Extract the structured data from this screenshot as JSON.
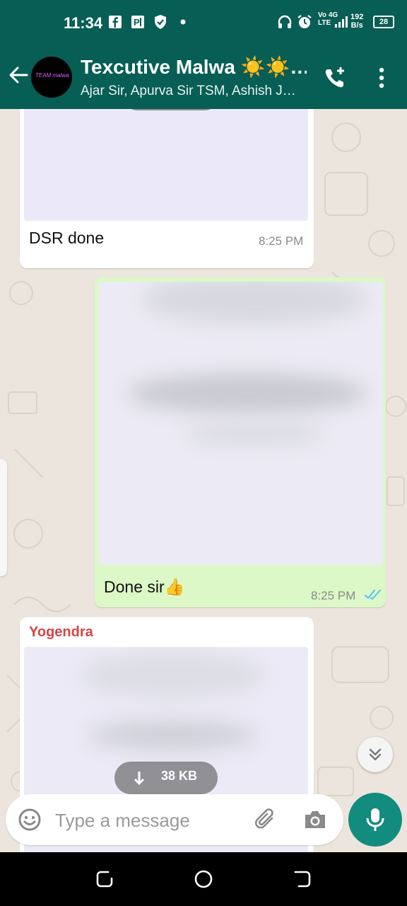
{
  "status_bar": {
    "time": "11:34",
    "network_top": "Vo 4G",
    "network_bottom": "LTE",
    "speed_value": "192",
    "speed_unit": "B/s",
    "battery": "28",
    "icons": [
      "facebook-icon",
      "parking-icon",
      "shield-icon",
      "dot-icon",
      "headphones-icon",
      "alarm-icon",
      "signal-icon",
      "battery-icon"
    ]
  },
  "header": {
    "title": "Texcutive Malwa ☀️☀️…",
    "subtitle": "Ajar Sir, Apurva Sir TSM, Ashish J…",
    "avatar_text": "TEAM malwa"
  },
  "messages": [
    {
      "direction": "incoming",
      "caption": "DSR done",
      "time": "8:25 PM"
    },
    {
      "direction": "outgoing",
      "caption": "Done sir👍",
      "time": "8:25 PM",
      "status": "read"
    },
    {
      "direction": "incoming",
      "sender": "Yogendra",
      "attachment_size": "38 KB"
    }
  ],
  "input": {
    "placeholder": "Type a message"
  },
  "colors": {
    "header": "#075e54",
    "chat_bg": "#ece5dd",
    "outgoing_bubble": "#dcf8c6",
    "incoming_bubble": "#ffffff",
    "mic_button": "#128c7e",
    "read_ticks": "#4fc3f7",
    "sender_name": "#d64545"
  }
}
